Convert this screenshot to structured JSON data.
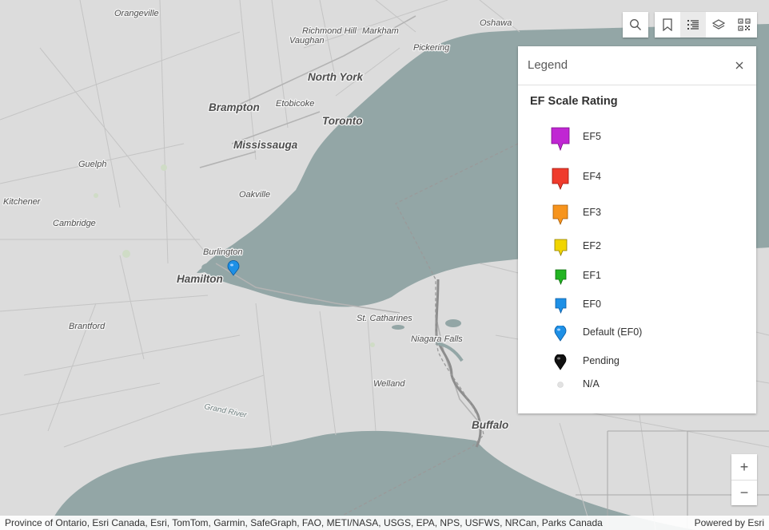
{
  "map": {
    "labels": {
      "orangeville": "Orangeville",
      "richmond_hill": "Richmond Hill",
      "markham": "Markham",
      "oshawa": "Oshawa",
      "vaughan": "Vaughan",
      "pickering": "Pickering",
      "north_york": "North York",
      "brampton": "Brampton",
      "etobicoke": "Etobicoke",
      "toronto": "Toronto",
      "mississauga": "Mississauga",
      "guelph": "Guelph",
      "oakville": "Oakville",
      "kitchener": "Kitchener",
      "cambridge": "Cambridge",
      "burlington": "Burlington",
      "hamilton": "Hamilton",
      "brantford": "Brantford",
      "st_catharines": "St. Catharines",
      "niagara_falls": "Niagara Falls",
      "welland": "Welland",
      "grand_river": "Grand River",
      "buffalo": "Buffalo"
    },
    "colors": {
      "land": "#dcdcdc",
      "water": "#93a6a6",
      "roads": "#c4c4c4",
      "border": "#9a9a9a"
    }
  },
  "toolbar": {
    "buttons": [
      {
        "icon": "search-icon",
        "active": false
      },
      {
        "icon": "bookmark-icon",
        "active": false
      },
      {
        "icon": "legend-list-icon",
        "active": true
      },
      {
        "icon": "layers-icon",
        "active": false
      },
      {
        "icon": "qr-code-icon",
        "active": false
      }
    ]
  },
  "legend": {
    "title": "Legend",
    "close_icon": "close-icon",
    "layer_title": "EF Scale Rating",
    "items": [
      {
        "label": "EF5",
        "color": "#c026d3",
        "shape": "square-pin"
      },
      {
        "label": "EF4",
        "color": "#ef3b2c",
        "shape": "square-pin"
      },
      {
        "label": "EF3",
        "color": "#f7941d",
        "shape": "square-pin"
      },
      {
        "label": "EF2",
        "color": "#f1d500",
        "shape": "square-pin"
      },
      {
        "label": "EF1",
        "color": "#22b422",
        "shape": "square-pin"
      },
      {
        "label": "EF0",
        "color": "#1e90e6",
        "shape": "square-pin"
      },
      {
        "label": "Default (EF0)",
        "color": "#1e90e6",
        "shape": "round-pin"
      },
      {
        "label": "Pending",
        "color": "#111111",
        "shape": "round-pin"
      },
      {
        "label": "N/A",
        "color": "#d9d9d9",
        "shape": "dot"
      }
    ]
  },
  "zoom": {
    "in_label": "+",
    "out_label": "−"
  },
  "attribution": {
    "text": "Province of Ontario, Esri Canada, Esri, TomTom, Garmin, SafeGraph, FAO, METI/NASA, USGS, EPA, NPS, USFWS, NRCan, Parks Canada",
    "powered_by": "Powered by Esri"
  }
}
